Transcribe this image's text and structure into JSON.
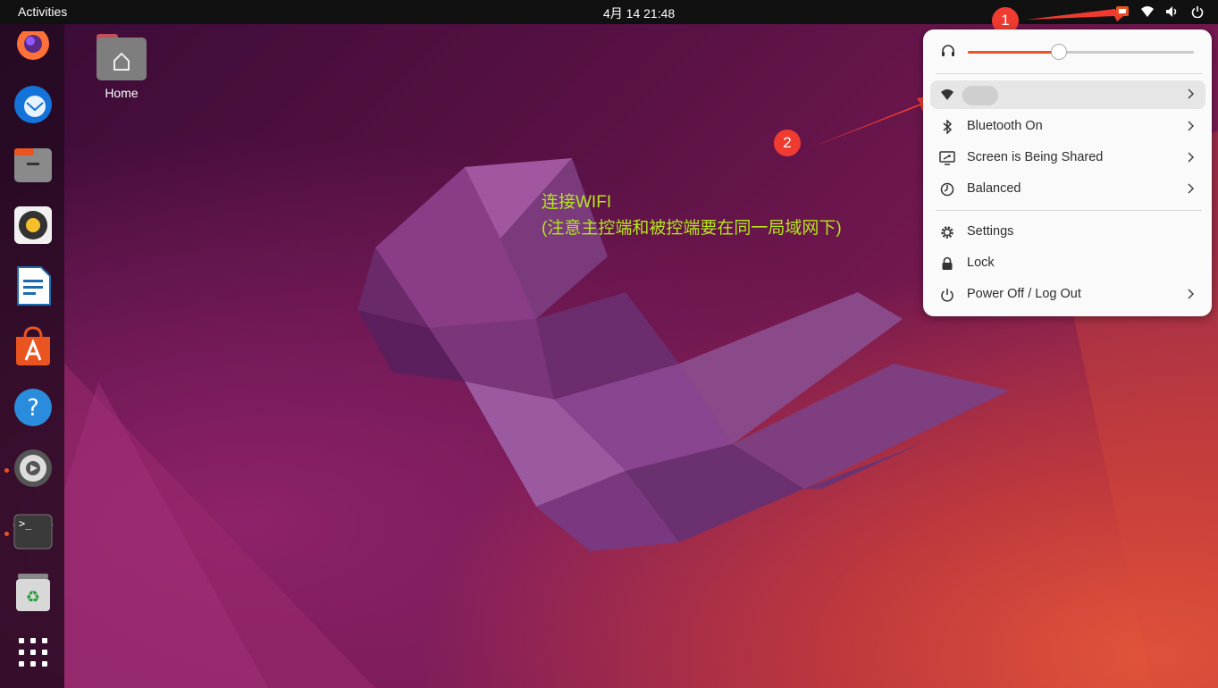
{
  "topbar": {
    "activities": "Activities",
    "clock": "4月 14  21:48",
    "tray_icons": [
      "screen-share-icon",
      "wifi-icon",
      "volume-icon",
      "power-icon"
    ]
  },
  "dock": {
    "apps": [
      "firefox-icon",
      "thunderbird-icon",
      "files-icon",
      "rhythmbox-icon",
      "libreoffice-writer-icon",
      "app-center-icon",
      "help-icon",
      "settings-icon",
      "terminal-icon",
      "trash-icon",
      "show-apps-icon"
    ]
  },
  "desktop": {
    "home_label": "Home"
  },
  "annotation": {
    "line1": "连接WIFI",
    "line2": "(注意主控端和被控端要在同一局域网下)",
    "marker1": "1",
    "marker2": "2"
  },
  "menu": {
    "volume_level": 0.4,
    "items": [
      {
        "label": "",
        "icon": "wifi-icon",
        "chevron": true
      },
      {
        "label": "Bluetooth On",
        "icon": "bluetooth-icon",
        "chevron": true
      },
      {
        "label": "Screen is Being Shared",
        "icon": "screen-share-icon",
        "chevron": true
      },
      {
        "label": "Balanced",
        "icon": "power-profile-icon",
        "chevron": true
      },
      {
        "label": "Settings",
        "icon": "gear-icon",
        "chevron": false
      },
      {
        "label": "Lock",
        "icon": "lock-icon",
        "chevron": false
      },
      {
        "label": "Power Off / Log Out",
        "icon": "power-icon",
        "chevron": true
      }
    ]
  },
  "colors": {
    "accent": "#e95420",
    "annotation_text": "#b5e61d",
    "marker": "#f03c30"
  }
}
